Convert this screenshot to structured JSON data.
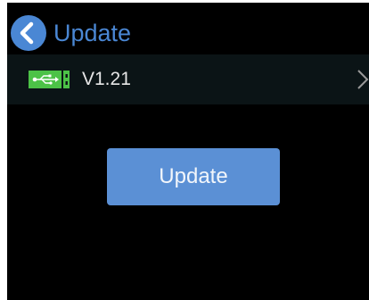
{
  "header": {
    "title": "Update",
    "back_icon": "chevron-left-icon"
  },
  "firmware_row": {
    "icon": "usb-icon",
    "version": "V1.21",
    "chevron_icon": "chevron-right-icon"
  },
  "actions": {
    "update_label": "Update"
  },
  "colors": {
    "accent": "#4a87d4",
    "button": "#5b90d5",
    "usb_badge": "#4cc247",
    "background": "#000000",
    "row_background": "#0b1416"
  }
}
